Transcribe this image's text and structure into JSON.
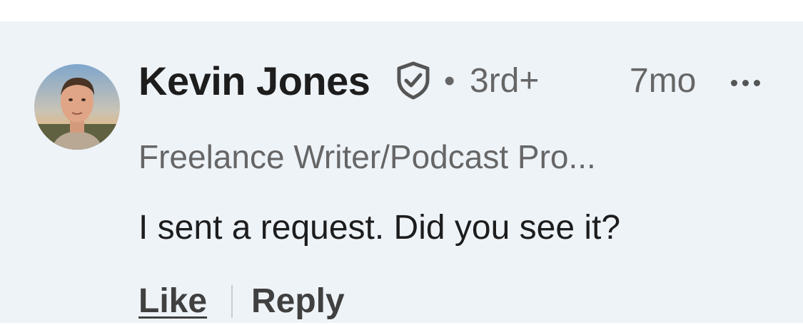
{
  "comment": {
    "author": {
      "name": "Kevin Jones",
      "verified_icon": "verified-shield-icon",
      "separator": "•",
      "degree": "3rd+",
      "headline": "Freelance Writer/Podcast Pro...",
      "avatar_icon": "profile-photo"
    },
    "timestamp": "7mo",
    "more_icon": "ellipsis-icon",
    "text": "I sent a request. Did you see it?",
    "actions": {
      "like_label": "Like",
      "reply_label": "Reply"
    }
  },
  "colors": {
    "card_background": "#eef3f8",
    "primary_text": "#1d1d1d",
    "secondary_text": "#666666",
    "action_text": "#404040"
  }
}
